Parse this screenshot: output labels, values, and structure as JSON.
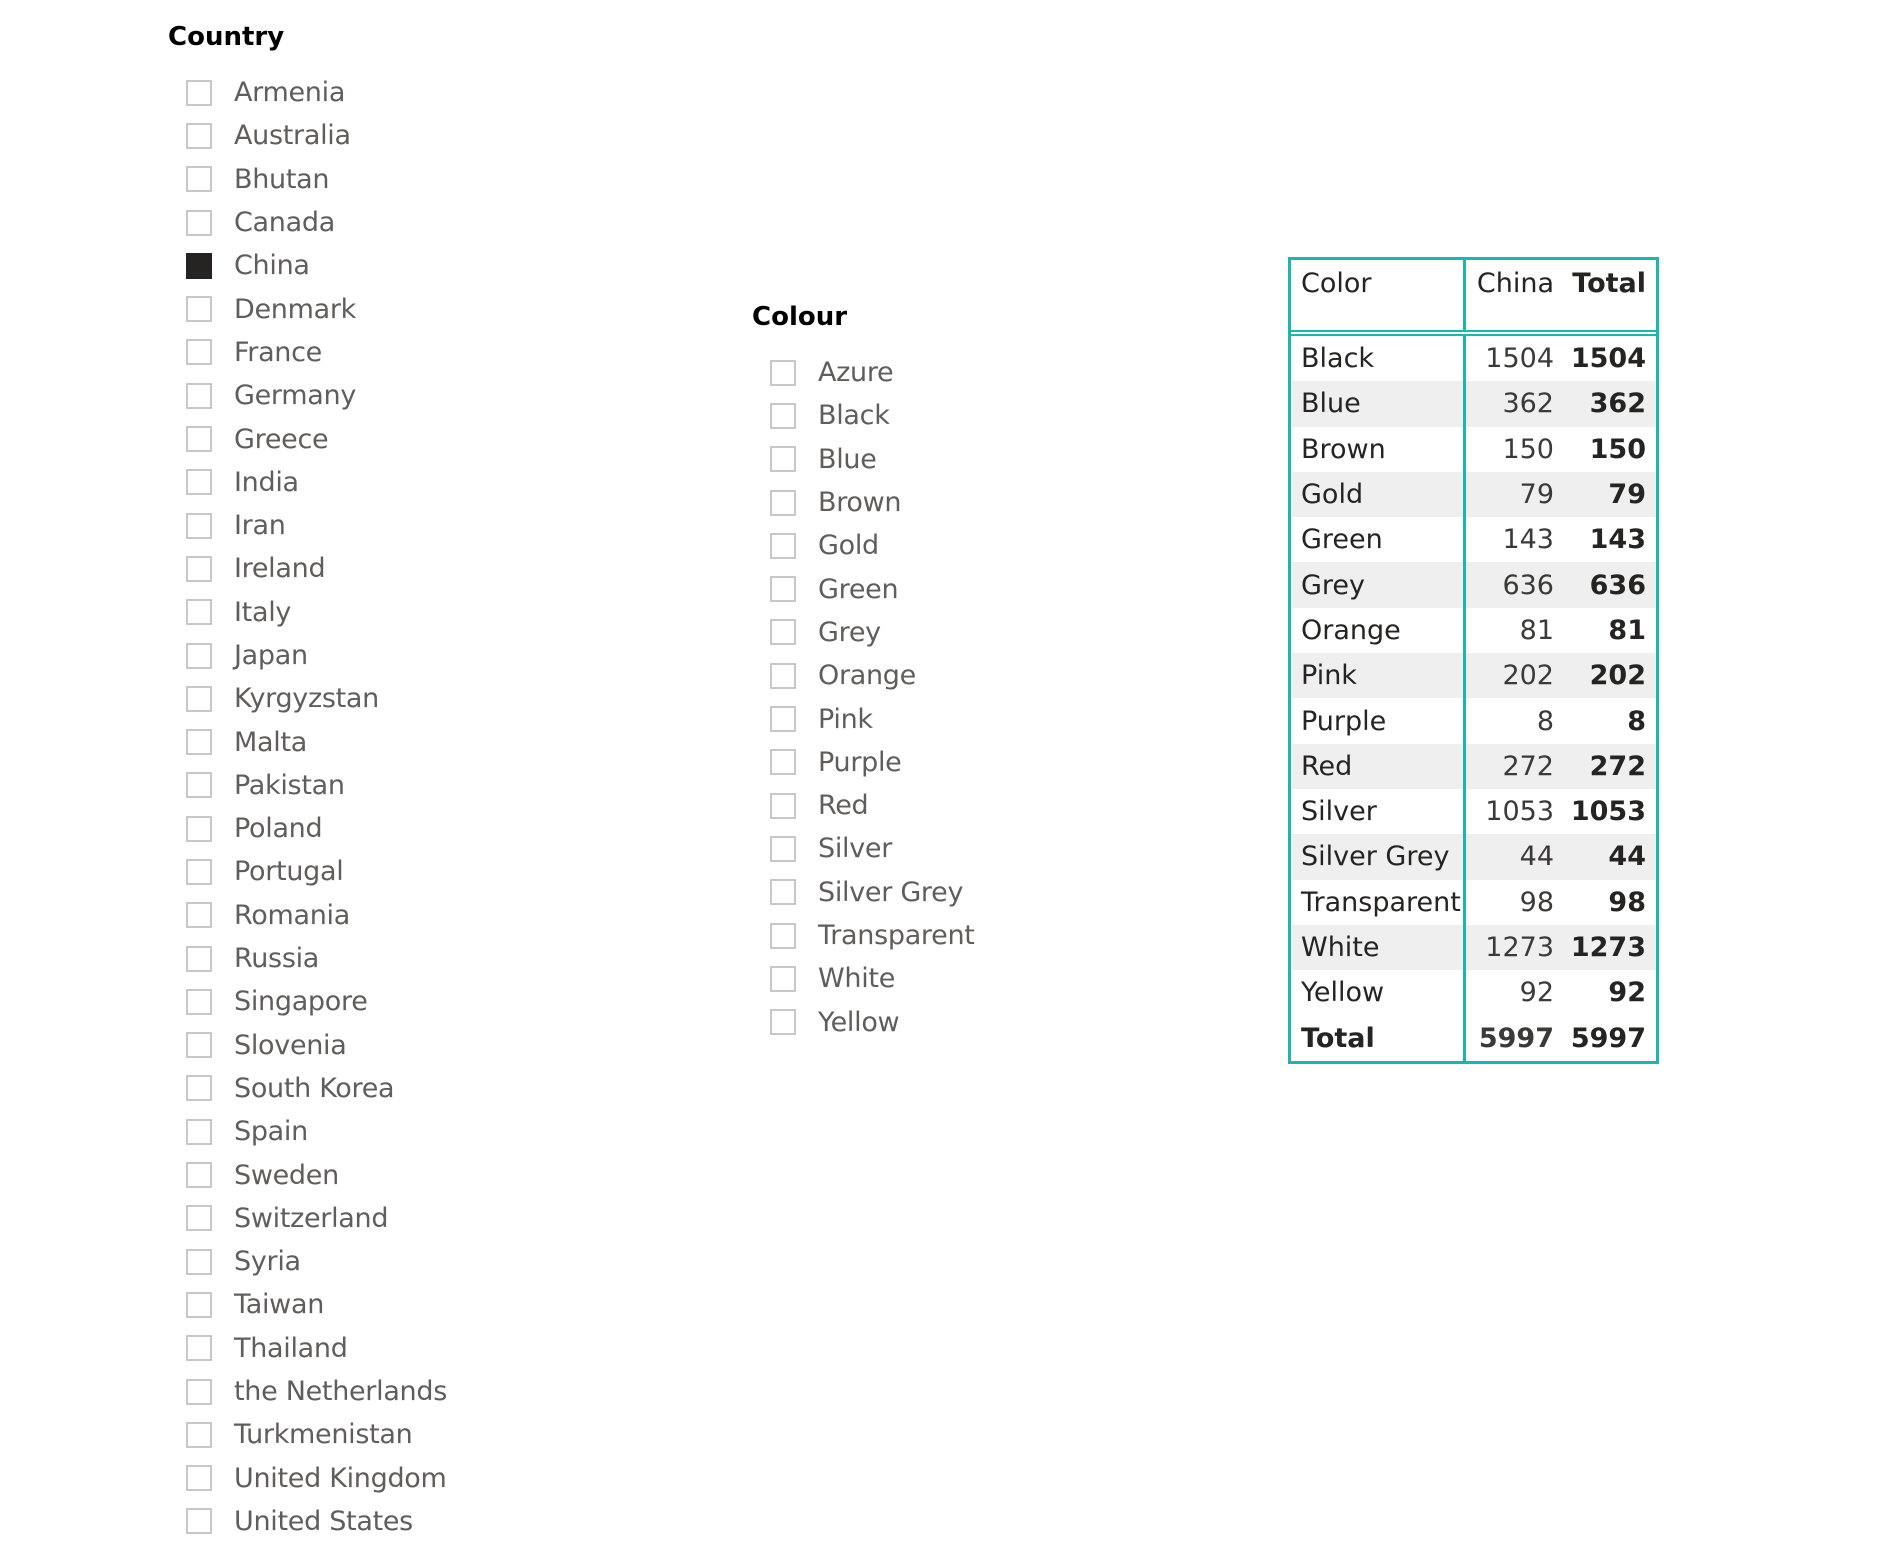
{
  "country_slicer": {
    "title": "Country",
    "items": [
      {
        "label": "Armenia",
        "checked": false
      },
      {
        "label": "Australia",
        "checked": false
      },
      {
        "label": "Bhutan",
        "checked": false
      },
      {
        "label": "Canada",
        "checked": false
      },
      {
        "label": "China",
        "checked": true
      },
      {
        "label": "Denmark",
        "checked": false
      },
      {
        "label": "France",
        "checked": false
      },
      {
        "label": "Germany",
        "checked": false
      },
      {
        "label": "Greece",
        "checked": false
      },
      {
        "label": "India",
        "checked": false
      },
      {
        "label": "Iran",
        "checked": false
      },
      {
        "label": "Ireland",
        "checked": false
      },
      {
        "label": "Italy",
        "checked": false
      },
      {
        "label": "Japan",
        "checked": false
      },
      {
        "label": "Kyrgyzstan",
        "checked": false
      },
      {
        "label": "Malta",
        "checked": false
      },
      {
        "label": "Pakistan",
        "checked": false
      },
      {
        "label": "Poland",
        "checked": false
      },
      {
        "label": "Portugal",
        "checked": false
      },
      {
        "label": "Romania",
        "checked": false
      },
      {
        "label": "Russia",
        "checked": false
      },
      {
        "label": "Singapore",
        "checked": false
      },
      {
        "label": "Slovenia",
        "checked": false
      },
      {
        "label": "South Korea",
        "checked": false
      },
      {
        "label": "Spain",
        "checked": false
      },
      {
        "label": "Sweden",
        "checked": false
      },
      {
        "label": "Switzerland",
        "checked": false
      },
      {
        "label": "Syria",
        "checked": false
      },
      {
        "label": "Taiwan",
        "checked": false
      },
      {
        "label": "Thailand",
        "checked": false
      },
      {
        "label": "the Netherlands",
        "checked": false
      },
      {
        "label": "Turkmenistan",
        "checked": false
      },
      {
        "label": "United Kingdom",
        "checked": false
      },
      {
        "label": "United States",
        "checked": false
      }
    ]
  },
  "colour_slicer": {
    "title": "Colour",
    "items": [
      {
        "label": "Azure",
        "checked": false
      },
      {
        "label": "Black",
        "checked": false
      },
      {
        "label": "Blue",
        "checked": false
      },
      {
        "label": "Brown",
        "checked": false
      },
      {
        "label": "Gold",
        "checked": false
      },
      {
        "label": "Green",
        "checked": false
      },
      {
        "label": "Grey",
        "checked": false
      },
      {
        "label": "Orange",
        "checked": false
      },
      {
        "label": "Pink",
        "checked": false
      },
      {
        "label": "Purple",
        "checked": false
      },
      {
        "label": "Red",
        "checked": false
      },
      {
        "label": "Silver",
        "checked": false
      },
      {
        "label": "Silver Grey",
        "checked": false
      },
      {
        "label": "Transparent",
        "checked": false
      },
      {
        "label": "White",
        "checked": false
      },
      {
        "label": "Yellow",
        "checked": false
      }
    ]
  },
  "matrix": {
    "headers": {
      "color": "Color",
      "country": "China",
      "total": "Total"
    },
    "rows": [
      {
        "color": "Black",
        "china": "1504",
        "total": "1504"
      },
      {
        "color": "Blue",
        "china": "362",
        "total": "362"
      },
      {
        "color": "Brown",
        "china": "150",
        "total": "150"
      },
      {
        "color": "Gold",
        "china": "79",
        "total": "79"
      },
      {
        "color": "Green",
        "china": "143",
        "total": "143"
      },
      {
        "color": "Grey",
        "china": "636",
        "total": "636"
      },
      {
        "color": "Orange",
        "china": "81",
        "total": "81"
      },
      {
        "color": "Pink",
        "china": "202",
        "total": "202"
      },
      {
        "color": "Purple",
        "china": "8",
        "total": "8"
      },
      {
        "color": "Red",
        "china": "272",
        "total": "272"
      },
      {
        "color": "Silver",
        "china": "1053",
        "total": "1053"
      },
      {
        "color": "Silver Grey",
        "china": "44",
        "total": "44"
      },
      {
        "color": "Transparent",
        "china": "98",
        "total": "98"
      },
      {
        "color": "White",
        "china": "1273",
        "total": "1273"
      },
      {
        "color": "Yellow",
        "china": "92",
        "total": "92"
      }
    ],
    "total_row": {
      "color": "Total",
      "china": "5997",
      "total": "5997"
    }
  },
  "colors": {
    "accent_border": "#1ab7ad",
    "checked_fill": "#252423",
    "stripe": "#efefef"
  }
}
